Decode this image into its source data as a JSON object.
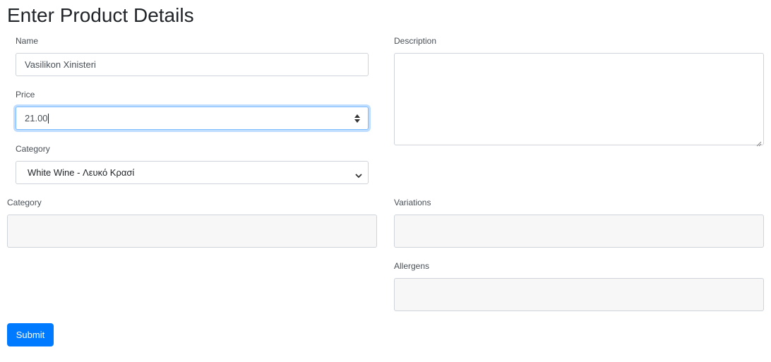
{
  "page": {
    "title": "Enter Product Details"
  },
  "form": {
    "name": {
      "label": "Name",
      "value": "Vasilikon Xinisteri"
    },
    "price": {
      "label": "Price",
      "value": "21.00"
    },
    "category_select": {
      "label": "Category",
      "value": "White Wine - Λευκό Κρασί"
    },
    "description": {
      "label": "Description",
      "value": ""
    },
    "category_box": {
      "label": "Category"
    },
    "variations": {
      "label": "Variations"
    },
    "allergens": {
      "label": "Allergens"
    },
    "submit_label": "Submit"
  },
  "icons": {
    "spinner": "number-spinner-icon",
    "select_chevron": "chevron-down-icon",
    "resize": "resize-grip-icon"
  },
  "colors": {
    "accent": "#007bff",
    "focus_border": "#80bdff",
    "readonly_bg": "#f7f7f7"
  }
}
